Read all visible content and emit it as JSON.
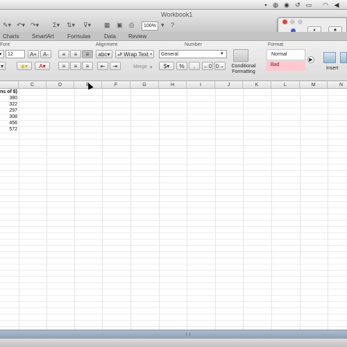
{
  "window": {
    "title": "Workbook1"
  },
  "toolbar": {
    "zoom": "100%"
  },
  "tabs": [
    "Charts",
    "SmartArt",
    "Formulas",
    "Data",
    "Review"
  ],
  "ribbon": {
    "font_group": "Font",
    "font_size": "12",
    "alignment_group": "Alignment",
    "wrap_text": "Wrap Text",
    "merge": "Merge",
    "abc": "abc",
    "number_group": "Number",
    "number_format": "General",
    "percent": "%",
    "comma": ",",
    "format_group": "Format",
    "conditional_formatting": [
      "Conditional",
      "Formatting"
    ],
    "style_normal": "Normal",
    "style_bad": "Bad",
    "insert": "Insert"
  },
  "columns": [
    "C",
    "D",
    "E",
    "F",
    "G",
    "H",
    "I",
    "J",
    "K",
    "L",
    "M",
    "N"
  ],
  "cells": {
    "header_fragment": "ns of $)",
    "values": [
      "380",
      "322",
      "297",
      "308",
      "456",
      "572"
    ]
  },
  "colors": {
    "bad_fill": "#ffc7ce",
    "bad_text": "#9c0006",
    "scrollbar": "#9db0c4"
  }
}
